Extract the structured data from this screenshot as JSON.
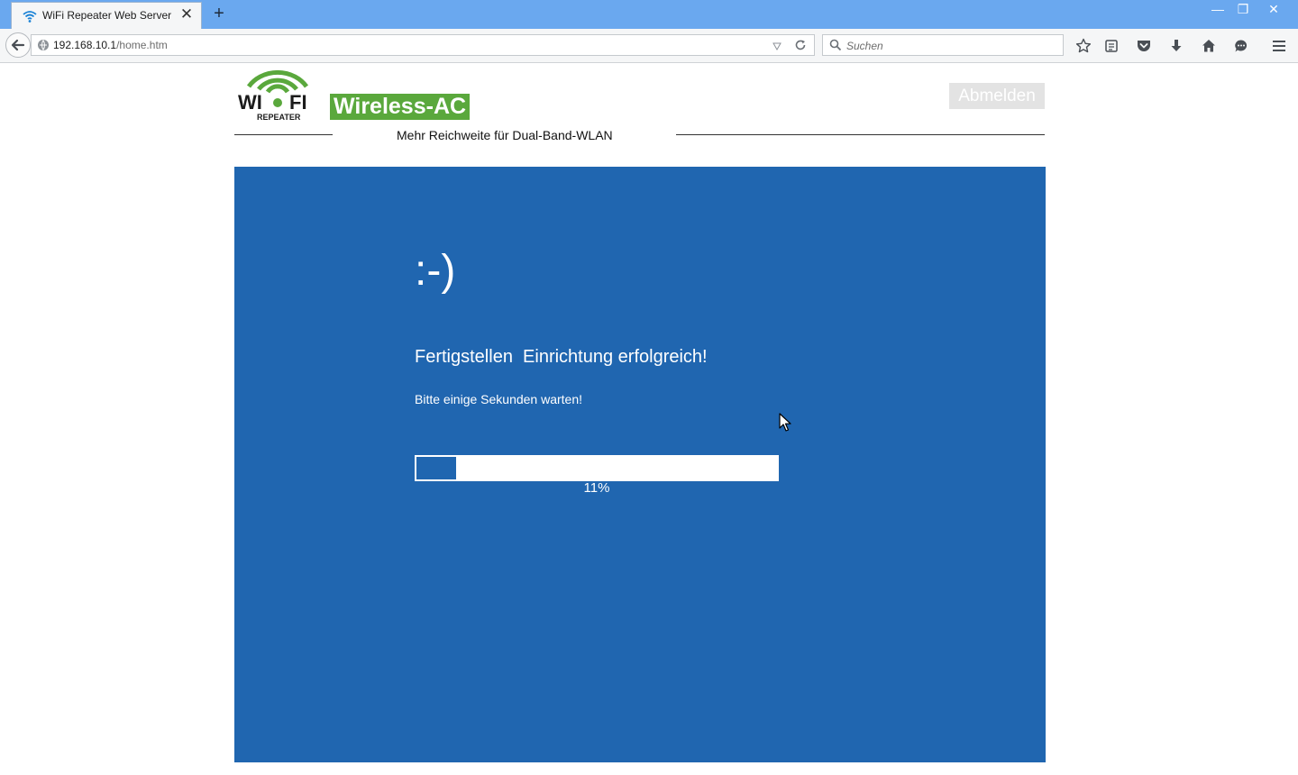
{
  "browser": {
    "tab_title": "WiFi Repeater Web Server",
    "url_host": "192.168.10.1",
    "url_path": "/home.htm",
    "search_placeholder": "Suchen"
  },
  "header": {
    "logo_wordmark": "WI FI",
    "logo_subtext": "REPEATER",
    "brand_badge": "Wireless-AC",
    "logout_label": "Abmelden",
    "tagline": "Mehr Reichweite für Dual-Band-WLAN"
  },
  "main": {
    "smiley": ":-)",
    "heading": "Fertigstellen  Einrichtung erfolgreich!",
    "wait_text": "Bitte einige Sekunden warten!",
    "progress_percent": 11,
    "progress_label": "11%"
  },
  "colors": {
    "panel_blue": "#2066b0",
    "brand_green": "#5aa83c",
    "titlebar_blue": "#6aa8ef"
  }
}
